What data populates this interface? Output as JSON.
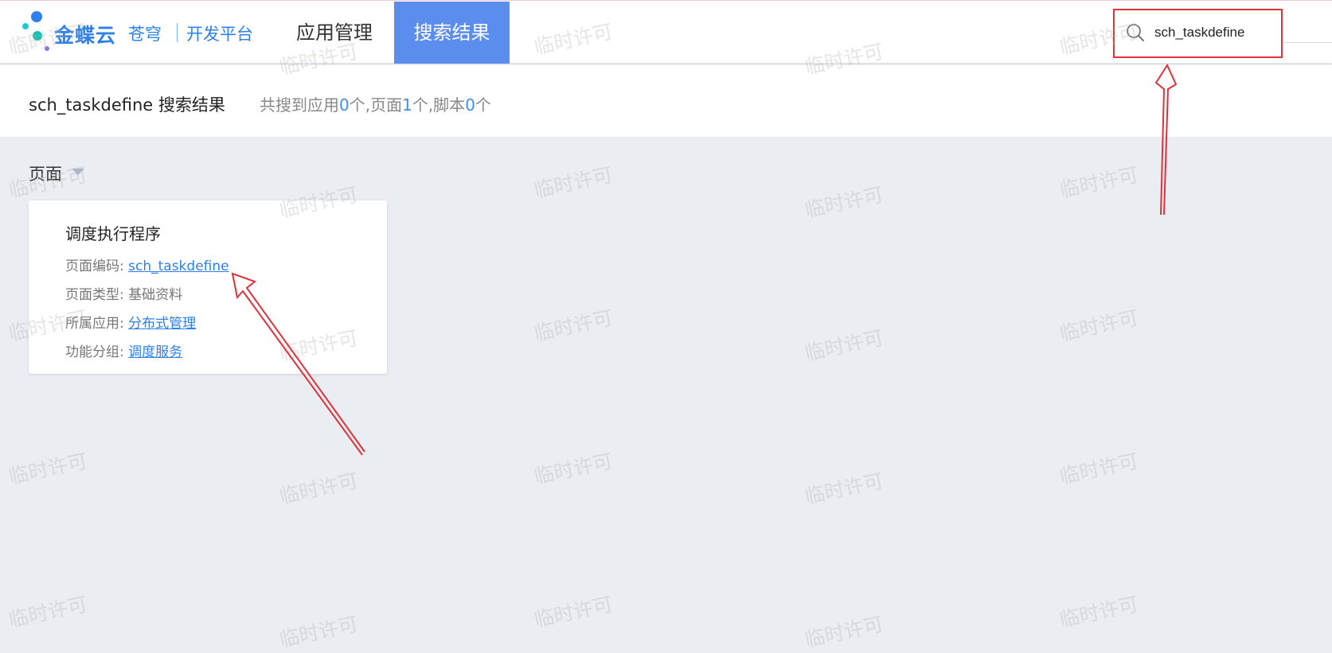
{
  "brand": {
    "name": "金蝶云",
    "sub": "苍穹",
    "platform": "开发平台"
  },
  "nav": {
    "tabs": [
      {
        "label": "应用管理",
        "active": false
      },
      {
        "label": "搜索结果",
        "active": true
      }
    ]
  },
  "search": {
    "value": "sch_taskdefine"
  },
  "result": {
    "title": "sch_taskdefine 搜索结果",
    "stats_prefix": "共搜到应用",
    "app_count": "0",
    "stats_mid1": "个,页面",
    "page_count": "1",
    "stats_mid2": "个,脚本",
    "script_count": "0",
    "stats_suffix": "个"
  },
  "section": {
    "label": "页面"
  },
  "card": {
    "title": "调度执行程序",
    "rows": [
      {
        "label": "页面编码:",
        "value": "sch_taskdefine",
        "link": true
      },
      {
        "label": "页面类型:",
        "value": "基础资料",
        "link": false
      },
      {
        "label": "所属应用:",
        "value": "分布式管理",
        "link": true
      },
      {
        "label": "功能分组:",
        "value": "调度服务",
        "link": true
      }
    ]
  },
  "watermark_text": "临时许可",
  "colors": {
    "accent": "#5b8def",
    "link": "#2f80e8",
    "annotation": "#e0323b",
    "background": "#eaedf2"
  }
}
